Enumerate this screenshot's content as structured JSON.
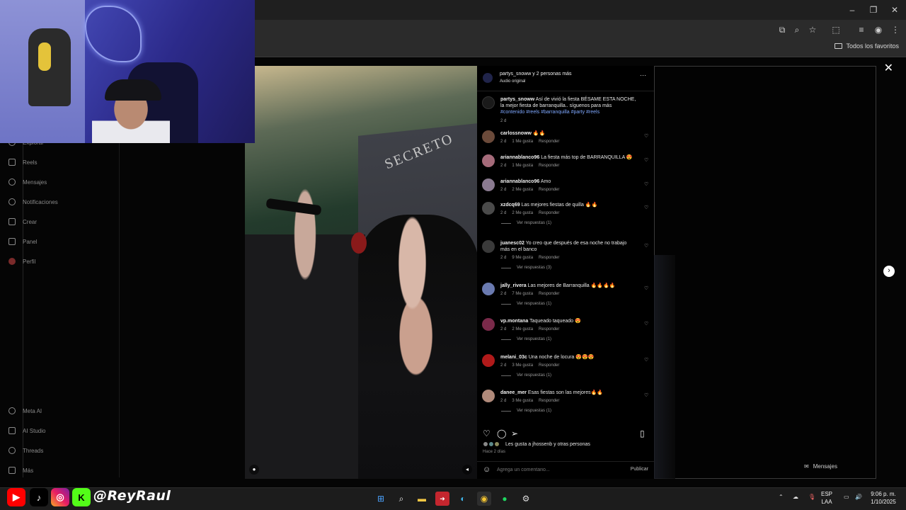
{
  "browser": {
    "bookmarks_label": "Todos los favoritos",
    "window": {
      "minimize": "–",
      "restore": "❐",
      "close": "✕"
    },
    "toolbar_icons": [
      "cast-icon",
      "zoom-icon",
      "star-icon",
      "extensions-icon",
      "media-icon",
      "profile-icon",
      "menu-icon"
    ]
  },
  "sidebar": {
    "items": [
      {
        "label": "Explorar",
        "icon": "compass-icon"
      },
      {
        "label": "Reels",
        "icon": "reels-icon"
      },
      {
        "label": "Mensajes",
        "icon": "messenger-icon"
      },
      {
        "label": "Notificaciones",
        "icon": "heart-icon"
      },
      {
        "label": "Crear",
        "icon": "plus-icon"
      },
      {
        "label": "Panel",
        "icon": "chart-icon"
      },
      {
        "label": "Perfil",
        "icon": "avatar"
      }
    ],
    "bottom": [
      {
        "label": "Meta AI",
        "icon": "meta-ai-icon"
      },
      {
        "label": "AI Studio",
        "icon": "ai-studio-icon"
      },
      {
        "label": "Threads",
        "icon": "threads-icon"
      },
      {
        "label": "Más",
        "icon": "menu-icon"
      }
    ]
  },
  "video": {
    "sign_text": "SECRETO"
  },
  "post": {
    "header_user": "partys_snoww y 2 personas más",
    "header_sub": "Audio original",
    "caption_user": "partys_snoww",
    "caption_text": " Así de vivió la fiesta BÉSAME ESTA NOCHE, la mejor fiesta de barranquilla.. síguenos para más",
    "caption_tags": "#contenido #reels #barranquilla #party #reels",
    "caption_time": "2 d",
    "more": "···"
  },
  "comments": [
    {
      "user": "carlossnoww",
      "text": "🔥🔥",
      "time": "2 d",
      "likes": "1 Me gusta",
      "reply": "Responder",
      "replies": ""
    },
    {
      "user": "ariannablanco96",
      "text": "La fiesta más top de BARRANQUILLA 😍",
      "time": "2 d",
      "likes": "1 Me gusta",
      "reply": "Responder",
      "replies": ""
    },
    {
      "user": "ariannablanco96",
      "text": "Amo",
      "time": "2 d",
      "likes": "2 Me gusta",
      "reply": "Responder",
      "replies": ""
    },
    {
      "user": "xzdcq69",
      "text": "Las mejores fiestas de quilla 🔥🔥",
      "time": "2 d",
      "likes": "2 Me gusta",
      "reply": "Responder",
      "replies": "Ver respuestas (1)"
    },
    {
      "user": "juanesc02",
      "text": "Yo creo que después de esa noche no trabajo más en el banco",
      "time": "2 d",
      "likes": "9 Me gusta",
      "reply": "Responder",
      "replies": "Ver respuestas (3)"
    },
    {
      "user": "jally_rivera",
      "text": "Las mejores de Barranquilla 🔥🔥🔥🔥",
      "time": "2 d",
      "likes": "7 Me gusta",
      "reply": "Responder",
      "replies": "Ver respuestas (1)"
    },
    {
      "user": "vp.montana",
      "text": "Taqueado taqueado 😍",
      "time": "2 d",
      "likes": "2 Me gusta",
      "reply": "Responder",
      "replies": "Ver respuestas (1)"
    },
    {
      "user": "melani_03c",
      "text": "Una noche de locura 😍😍😍",
      "time": "2 d",
      "likes": "3 Me gusta",
      "reply": "Responder",
      "replies": "Ver respuestas (1)"
    },
    {
      "user": "danee_mer",
      "text": "Esas fiestas son las mejores🔥🔥",
      "time": "2 d",
      "likes": "3 Me gusta",
      "reply": "Responder",
      "replies": "Ver respuestas (1)"
    }
  ],
  "footer": {
    "likes_text": "Les gusta a jhossenb y otras personas",
    "time_ago": "Hace 2 días",
    "comment_placeholder": "Agrega un comentario...",
    "publish": "Publicar"
  },
  "overlay": {
    "messages_label": "Mensajes",
    "handle": "@ReyRaul"
  },
  "taskbar": {
    "lang_top": "ESP",
    "lang_bottom": "LAA",
    "time": "9:06 p. m.",
    "date": "1/10/2025"
  },
  "colors": {
    "accent_link": "#7fa8ff",
    "panel_bg": "#000000",
    "brand_youtube": "#ff0000",
    "brand_kick": "#53fc18"
  }
}
